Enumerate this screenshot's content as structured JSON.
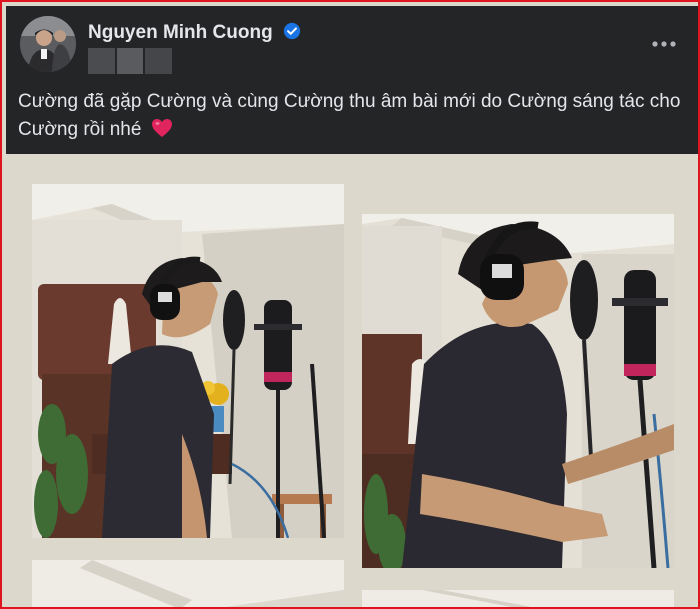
{
  "post": {
    "author": "Nguyen Minh Cuong",
    "verified": true,
    "caption": "Cường đã gặp Cường và cùng Cường thu âm bài mới do Cường sáng tác cho Cường rồi nhé",
    "caption_emoji": "heart-icon"
  },
  "icons": {
    "verified": "verified-badge-icon",
    "more": "more-options-icon",
    "heart": "red-heart-icon"
  },
  "colors": {
    "header_bg": "#242526",
    "text": "#e4e6eb",
    "verified_blue": "#1b74e4",
    "heart_red": "#e0245e",
    "frame_border": "#e0141e",
    "collage_bg": "#dcd8cc"
  },
  "photos": [
    {
      "subject": "singer-with-headphones-at-microphone"
    },
    {
      "subject": "singer-with-headphones-at-microphone-closeup"
    },
    {
      "subject": "ceiling-partial"
    },
    {
      "subject": "ceiling-partial"
    }
  ]
}
